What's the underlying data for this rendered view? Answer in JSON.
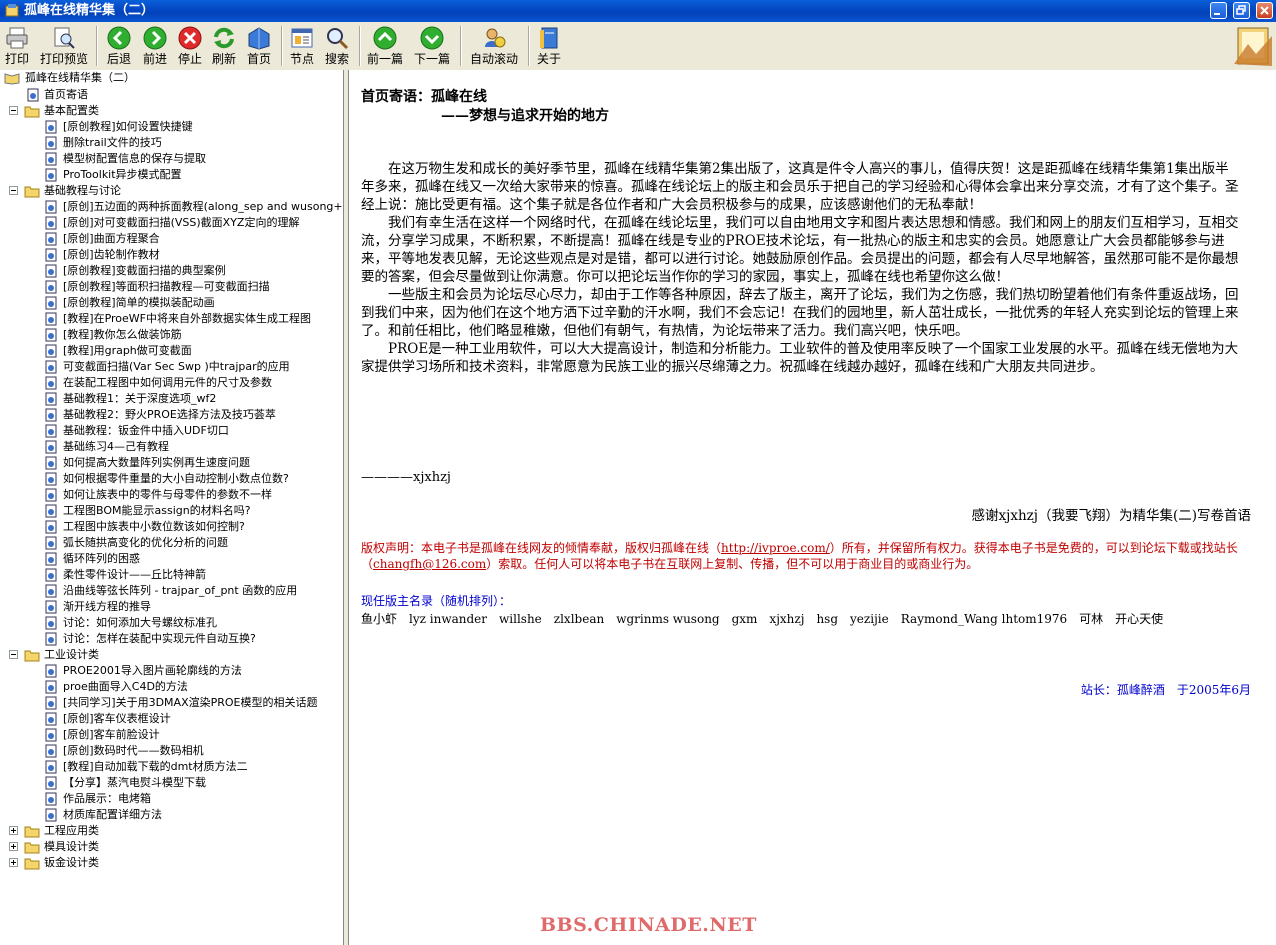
{
  "window": {
    "title": "孤峰在线精华集（二）"
  },
  "toolbar": {
    "print": "打印",
    "print_preview": "打印预览",
    "back": "后退",
    "forward": "前进",
    "stop": "停止",
    "refresh": "刷新",
    "home": "首页",
    "node": "节点",
    "search": "搜索",
    "prev": "前一篇",
    "next": "下一篇",
    "autoscroll": "自动滚动",
    "about": "关于"
  },
  "tree": {
    "root": "孤峰在线精华集（二）",
    "home": "首页寄语",
    "groups": [
      {
        "label": "基本配置类",
        "expanded": true,
        "items": [
          "[原创教程]如何设置快捷键",
          "删除trail文件的技巧",
          "模型树配置信息的保存与提取",
          "ProToolkit异步模式配置"
        ]
      },
      {
        "label": "基础教程与讨论",
        "expanded": true,
        "items": [
          "[原创]五边面的两种拆面教程(along_sep and wusong+2",
          "[原创]对可变截面扫描(VSS)截面XYZ定向的理解",
          "[原创]曲面方程聚合",
          "[原创]齿轮制作教材",
          "[原创教程]变截面扫描的典型案例",
          "[原创教程]等面积扫描教程—可变截面扫描",
          "[原创教程]简单的模拟装配动画",
          "[教程]在ProeWF中将来自外部数据实体生成工程图",
          "[教程]教你怎么做装饰筋",
          "[教程]用graph做可变截面",
          "可变截面扫描(Var Sec Swp )中trajpar的应用",
          "在装配工程图中如何调用元件的尺寸及参数",
          "基础教程1：关于深度选项_wf2",
          "基础教程2：野火PROE选择方法及技巧荟萃",
          "基础教程：钣金件中插入UDF切口",
          "基础练习4—己有教程",
          "如何提高大数量阵列实例再生速度问题",
          "如何根据零件重量的大小自动控制小数点位数?",
          "如何让族表中的零件与母零件的参数不一样",
          "工程图BOM能显示assign的材料名吗?",
          "工程图中族表中小数位数该如何控制?",
          "弧长随拱高变化的优化分析的问题",
          "循环阵列的困惑",
          "柔性零件设计——丘比特神箭",
          "沿曲线等弦长阵列 - trajpar_of_pnt 函数的应用",
          "渐开线方程的推导",
          "讨论：如何添加大号螺纹标准孔",
          "讨论：怎样在装配中实现元件自动互换?"
        ]
      },
      {
        "label": "工业设计类",
        "expanded": true,
        "items": [
          "PROE2001导入图片画轮廓线的方法",
          "proe曲面导入C4D的方法",
          "[共同学习]关于用3DMAX渲染PROE模型的相关话题",
          "[原创]客车仪表框设计",
          "[原创]客车前脸设计",
          "[原创]数码时代——数码相机",
          "[教程]自动加载下载的dmt材质方法二",
          "【分享】蒸汽电熨斗模型下载",
          "作品展示：电烤箱",
          "材质库配置详细方法"
        ]
      },
      {
        "label": "工程应用类",
        "expanded": false,
        "items": []
      },
      {
        "label": "模具设计类",
        "expanded": false,
        "items": []
      },
      {
        "label": "钣金设计类",
        "expanded": false,
        "items": []
      }
    ]
  },
  "content": {
    "title": "首页寄语：孤峰在线",
    "subtitle": "——梦想与追求开始的地方",
    "paragraphs": [
      "在这万物生发和成长的美好季节里，孤峰在线精华集第2集出版了，这真是件令人高兴的事儿，值得庆贺！这是距孤峰在线精华集第1集出版半年多来，孤峰在线又一次给大家带来的惊喜。孤峰在线论坛上的版主和会员乐于把自己的学习经验和心得体会拿出来分享交流，才有了这个集子。圣经上说：施比受更有福。这个集子就是各位作者和广大会员积极参与的成果，应该感谢他们的无私奉献！",
      "我们有幸生活在这样一个网络时代，在孤峰在线论坛里，我们可以自由地用文字和图片表达思想和情感。我们和网上的朋友们互相学习，互相交流，分享学习成果，不断积累，不断提高！孤峰在线是专业的PROE技术论坛，有一批热心的版主和忠实的会员。她愿意让广大会员都能够参与进来，平等地发表见解，无论这些观点是对是错，都可以进行讨论。她鼓励原创作品。会员提出的问题，都会有人尽早地解答，虽然那可能不是你最想要的答案，但会尽量做到让你满意。你可以把论坛当作你的学习的家园，事实上，孤峰在线也希望你这么做！",
      "一些版主和会员为论坛尽心尽力，却由于工作等各种原因，辞去了版主，离开了论坛，我们为之伤感，我们热切盼望着他们有条件重返战场，回到我们中来，因为他们在这个地方洒下过辛勤的汗水啊，我们不会忘记！在我们的园地里，新人茁壮成长，一批优秀的年轻人充实到论坛的管理上来了。和前任相比，他们略显稚嫩，但他们有朝气，有热情，为论坛带来了活力。我们高兴吧，快乐吧。",
      "PROE是一种工业用软件，可以大大提高设计，制造和分析能力。工业软件的普及使用率反映了一个国家工业发展的水平。孤峰在线无偿地为大家提供学习场所和技术资料，非常愿意为民族工业的振兴尽绵薄之力。祝孤峰在线越办越好，孤峰在线和广大朋友共同进步。"
    ],
    "signature": "————xjxhzj",
    "thanks": "感谢xjxhzj（我要飞翔）为精华集(二)写卷首语",
    "copyright_a": "版权声明：本电子书是孤峰在线网友的倾情奉献，版权归孤峰在线（",
    "copyright_link1": "http://ivproe.com/",
    "copyright_b": "）所有，并保留所有权力。获得本电子书是免费的，可以到论坛下载或找站长（",
    "copyright_link2": "changfh@126.com",
    "copyright_c": "）索取。任何人可以将本电子书在互联网上复制、传播，但不可以用于商业目的或商业行为。",
    "moderators_title": "现任版主名录（随机排列）：",
    "moderators": "鱼小虾　lyz inwander　willshe　zlxlbean　wgrinms wusong　gxm　xjxhzj　hsg　yezijie　Raymond_Wang lhtom1976　可林　开心天使",
    "admin": "站长：孤峰醉酒　于2005年6月"
  },
  "watermark": "BBS.CHINADE.NET"
}
